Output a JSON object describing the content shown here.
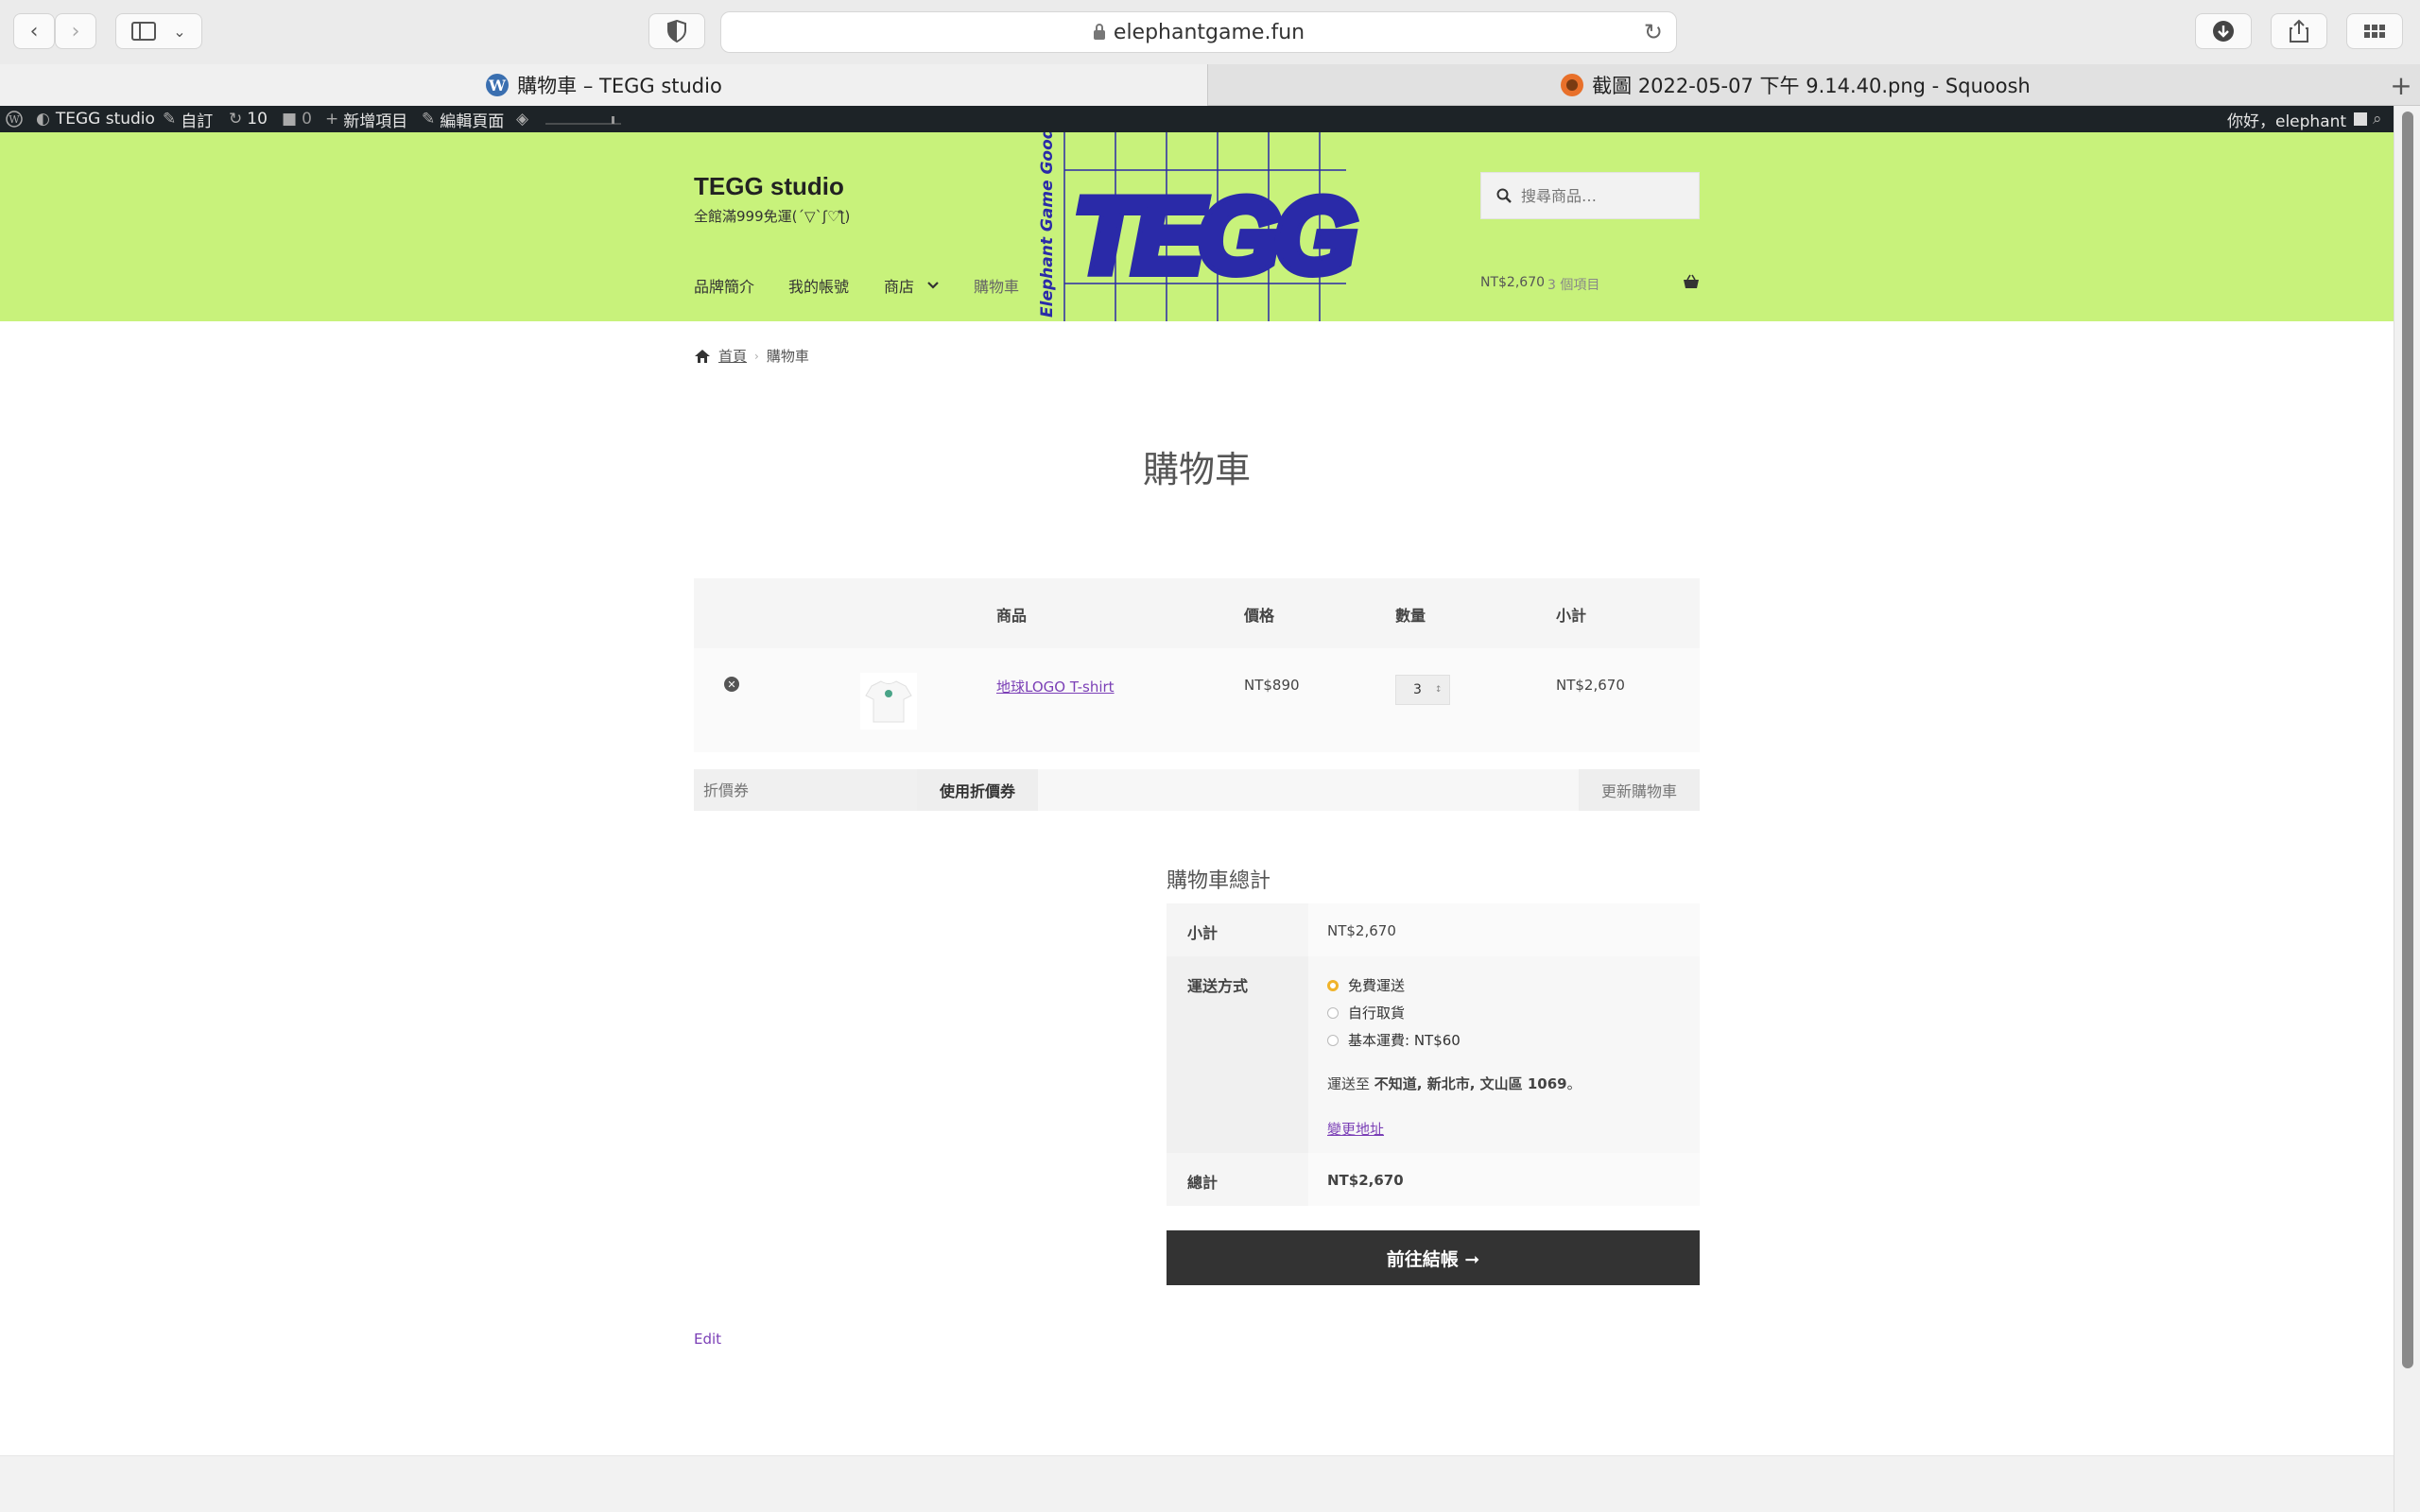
{
  "browser": {
    "url": "elephantgame.fun",
    "tabs": [
      {
        "title": "購物車 – TEGG studio"
      },
      {
        "title": "截圖 2022-05-07 下午 9.14.40.png - Squoosh"
      }
    ]
  },
  "adminbar": {
    "site_name": "TEGG studio",
    "customize": "自訂",
    "updates_count": "10",
    "comments_count": "0",
    "new_item": "新增項目",
    "edit_page": "編輯頁面",
    "greeting": "你好，elephant"
  },
  "site": {
    "title": "TEGG studio",
    "tagline": "全館滿999免運(´▽`ʃ♡ƪ)",
    "logo_text": "TEGG",
    "logo_side_text": "Elephant Game Good S",
    "search_placeholder": "搜尋商品…",
    "nav": [
      "品牌簡介",
      "我的帳號",
      "商店",
      "購物車"
    ],
    "cart_total": "NT$2,670",
    "cart_count": "3 個項目"
  },
  "breadcrumb": {
    "home": "首頁",
    "current": "購物車"
  },
  "page_title": "購物車",
  "cart_table": {
    "headers": {
      "product": "商品",
      "price": "價格",
      "quantity": "數量",
      "subtotal": "小計"
    },
    "items": [
      {
        "name": "地球LOGO T-shirt",
        "price": "NT$890",
        "quantity": "3",
        "subtotal": "NT$2,670"
      }
    ]
  },
  "coupon": {
    "placeholder": "折價券",
    "apply_label": "使用折價券",
    "update_label": "更新購物車"
  },
  "totals": {
    "heading": "購物車總計",
    "subtotal_label": "小計",
    "subtotal_value": "NT$2,670",
    "shipping_label": "運送方式",
    "shipping_options": [
      "免費運送",
      "自行取貨",
      "基本運費: NT$60"
    ],
    "selected_shipping": "免費運送",
    "shipping_to_prefix": "運送至",
    "shipping_address": "不知道, 新北市, 文山區 1069",
    "shipping_to_suffix": "。",
    "change_address": "變更地址",
    "total_label": "總計",
    "total_value": "NT$2,670",
    "checkout_label": "前往結帳 ➞"
  },
  "edit_link": "Edit",
  "colors": {
    "header_bg": "#c8f27b",
    "accent_link": "#7b3fb6",
    "checkout_bg": "#333333",
    "logo_blue": "#2a2aa8"
  }
}
